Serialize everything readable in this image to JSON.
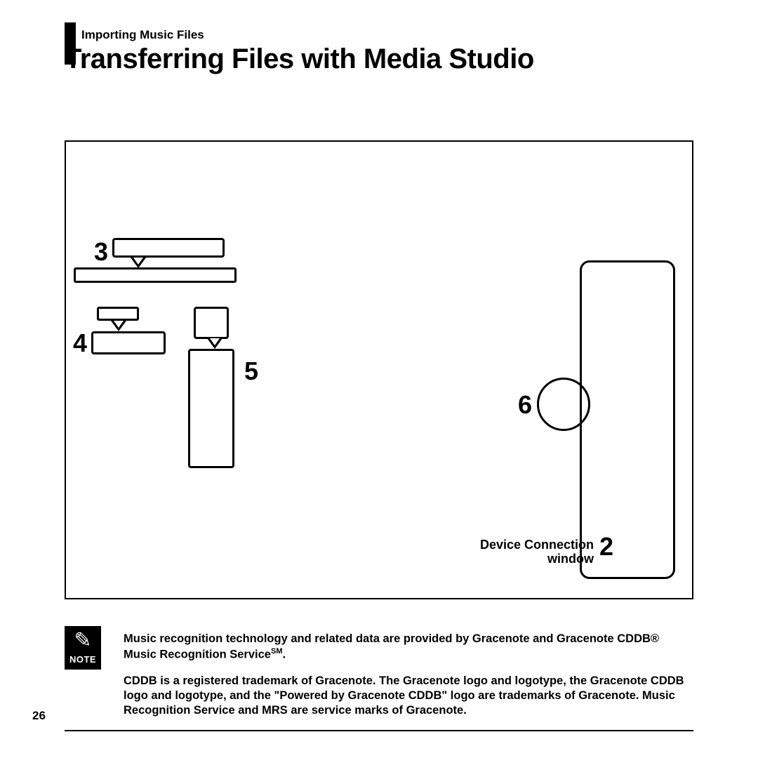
{
  "header": {
    "breadcrumb": "Importing Music Files",
    "title": "Transferring Files with Media Studio"
  },
  "callouts": {
    "n2": "2",
    "n3": "3",
    "n4": "4",
    "n5": "5",
    "n6": "6",
    "device_label_line1": "Device Connection",
    "device_label_line2": "window"
  },
  "note": {
    "label": "NOTE",
    "pencil_glyph": "✎",
    "para1_a": "Music recognition technology and related data are provided by Gracenote and Gracenote CDDB",
    "para1_reg": "®",
    "para1_b": " Music Recognition Service",
    "para1_sm": "SM",
    "para1_c": ".",
    "para2": "CDDB is a registered trademark of Gracenote. The Gracenote logo and logotype, the Gracenote CDDB logo and logotype, and the \"Powered by Gracenote CDDB\" logo are trademarks of Gracenote. Music Recognition Service and MRS are service marks of Gracenote."
  },
  "page_number": "26"
}
